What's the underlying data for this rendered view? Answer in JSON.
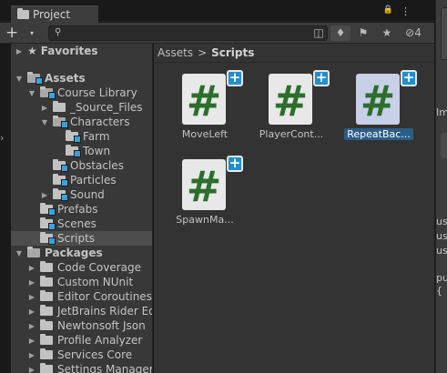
{
  "tab": {
    "title": "Project"
  },
  "search": {
    "placeholder": ""
  },
  "tabicons": {
    "lock": "🔒",
    "menu": "⋮"
  },
  "toolbar": {
    "hidden_count": "4",
    "add": "+",
    "dd": "▾"
  },
  "tree": [
    {
      "label": "Favorites",
      "indent": 0,
      "arrow": "▶",
      "icon": "star",
      "bold": true
    },
    {
      "label": "Assets",
      "indent": 0,
      "arrow": "▼",
      "icon": "asset",
      "bold": true
    },
    {
      "label": "Course Library",
      "indent": 1,
      "arrow": "▼",
      "icon": "asset"
    },
    {
      "label": "_Source_Files",
      "indent": 2,
      "arrow": "▶",
      "icon": "folder"
    },
    {
      "label": "Characters",
      "indent": 2,
      "arrow": "▼",
      "icon": "asset"
    },
    {
      "label": "Farm",
      "indent": 3,
      "arrow": "",
      "icon": "asset"
    },
    {
      "label": "Town",
      "indent": 3,
      "arrow": "",
      "icon": "asset"
    },
    {
      "label": "Obstacles",
      "indent": 2,
      "arrow": "",
      "icon": "asset"
    },
    {
      "label": "Particles",
      "indent": 2,
      "arrow": "",
      "icon": "asset"
    },
    {
      "label": "Sound",
      "indent": 2,
      "arrow": "▶",
      "icon": "asset"
    },
    {
      "label": "Prefabs",
      "indent": 1,
      "arrow": "",
      "icon": "asset"
    },
    {
      "label": "Scenes",
      "indent": 1,
      "arrow": "",
      "icon": "asset"
    },
    {
      "label": "Scripts",
      "indent": 1,
      "arrow": "",
      "icon": "asset",
      "selected": true
    },
    {
      "label": "Packages",
      "indent": 0,
      "arrow": "▼",
      "icon": "folder",
      "bold": true
    },
    {
      "label": "Code Coverage",
      "indent": 1,
      "arrow": "▶",
      "icon": "folder"
    },
    {
      "label": "Custom NUnit",
      "indent": 1,
      "arrow": "▶",
      "icon": "folder"
    },
    {
      "label": "Editor Coroutines",
      "indent": 1,
      "arrow": "▶",
      "icon": "folder"
    },
    {
      "label": "JetBrains Rider Edit",
      "indent": 1,
      "arrow": "▶",
      "icon": "folder"
    },
    {
      "label": "Newtonsoft Json",
      "indent": 1,
      "arrow": "▶",
      "icon": "folder"
    },
    {
      "label": "Profile Analyzer",
      "indent": 1,
      "arrow": "▶",
      "icon": "folder"
    },
    {
      "label": "Services Core",
      "indent": 1,
      "arrow": "▶",
      "icon": "folder"
    },
    {
      "label": "Settings Manager",
      "indent": 1,
      "arrow": "▶",
      "icon": "folder"
    }
  ],
  "breadcrumb": {
    "root": "Assets",
    "sep": ">",
    "current": "Scripts"
  },
  "files": [
    {
      "name": "MoveLeft",
      "glyph": "#",
      "badge": "+",
      "selected": false
    },
    {
      "name": "PlayerCont...",
      "glyph": "#",
      "badge": "+",
      "selected": false
    },
    {
      "name": "RepeatBac...",
      "glyph": "#",
      "badge": "+",
      "selected": true
    },
    {
      "name": "SpawnMa...",
      "glyph": "#",
      "badge": "+",
      "selected": false
    }
  ],
  "inspector": {
    "lines": [
      "Im",
      "us",
      "us",
      "us",
      "pu",
      "{"
    ]
  },
  "colors": {
    "accent": "#1f8fd2",
    "selection": "#2c5d87",
    "script_hash": "#2c6e2c"
  }
}
